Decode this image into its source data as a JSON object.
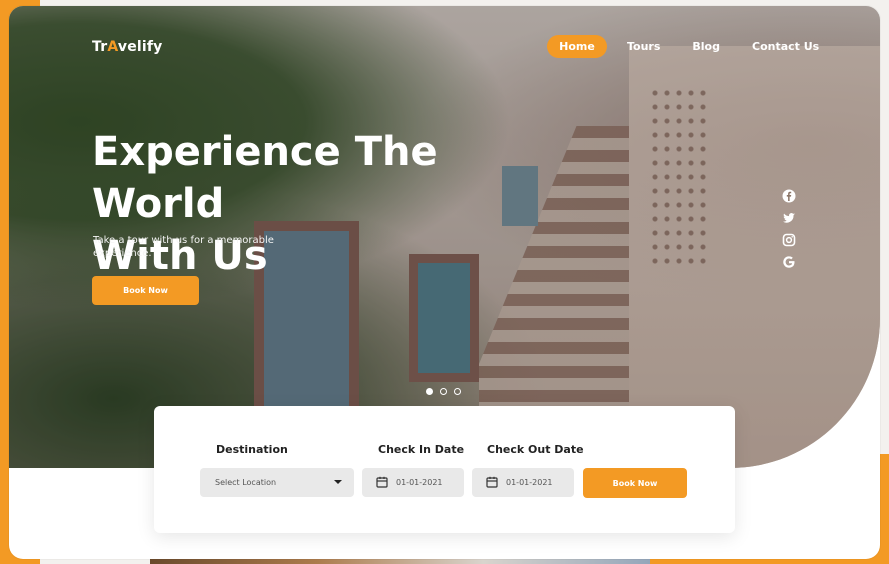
{
  "brand": {
    "logo_prefix": "Tr",
    "logo_mark": "A",
    "logo_suffix": "velify",
    "accent_color": "#f39a24"
  },
  "nav": {
    "items": [
      {
        "label": "Home",
        "active": true
      },
      {
        "label": "Tours"
      },
      {
        "label": "Blog"
      },
      {
        "label": "Contact Us"
      }
    ]
  },
  "hero": {
    "headline_line1": "Experience The World",
    "headline_line2": "With Us",
    "subtitle": "Take a tour with us for a memorable experience.",
    "cta_label": "Book Now"
  },
  "social": {
    "icons": [
      "facebook-icon",
      "twitter-icon",
      "instagram-icon",
      "google-icon"
    ]
  },
  "carousel": {
    "slide_count": 3,
    "active_index": 0
  },
  "booking": {
    "destination_label": "Destination",
    "destination_placeholder": "Select Location",
    "checkin_label": "Check In Date",
    "checkin_value": "01-01-2021",
    "checkout_label": "Check Out Date",
    "checkout_value": "01-01-2021",
    "submit_label": "Book Now"
  }
}
